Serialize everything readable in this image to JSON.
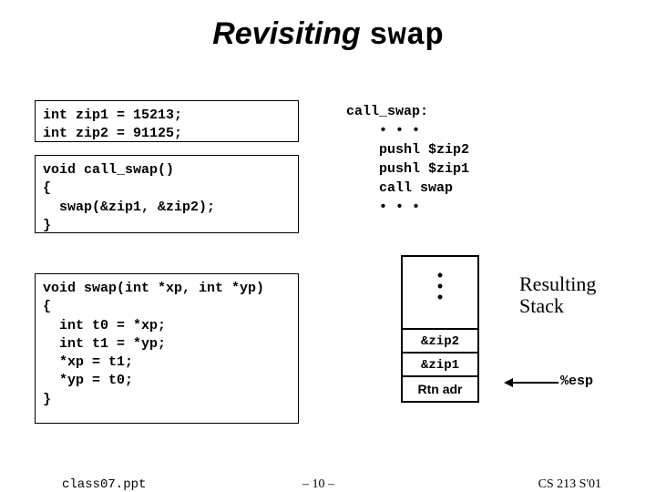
{
  "title_part1": "Revisiting ",
  "title_part2": "swap",
  "code_decls": "int zip1 = 15213;\nint zip2 = 91125;",
  "code_callswap": "void call_swap()\n{\n  swap(&zip1, &zip2);\n}",
  "code_swap": "void swap(int *xp, int *yp)\n{\n  int t0 = *xp;\n  int t1 = *yp;\n  *xp = t1;\n  *yp = t0;\n}",
  "asm": "call_swap:\n    • • •\n    pushl $zip2\n    pushl $zip1\n    call swap\n    • • •",
  "stack": {
    "dot": "•",
    "cells": [
      "&zip2",
      "&zip1"
    ],
    "rtn": "Rtn adr"
  },
  "resulting_l1": "Resulting",
  "resulting_l2": "Stack",
  "esp": "%esp",
  "footer": {
    "filename": "class07.ppt",
    "pagenum": "– 10 –",
    "course": "CS 213 S'01"
  }
}
